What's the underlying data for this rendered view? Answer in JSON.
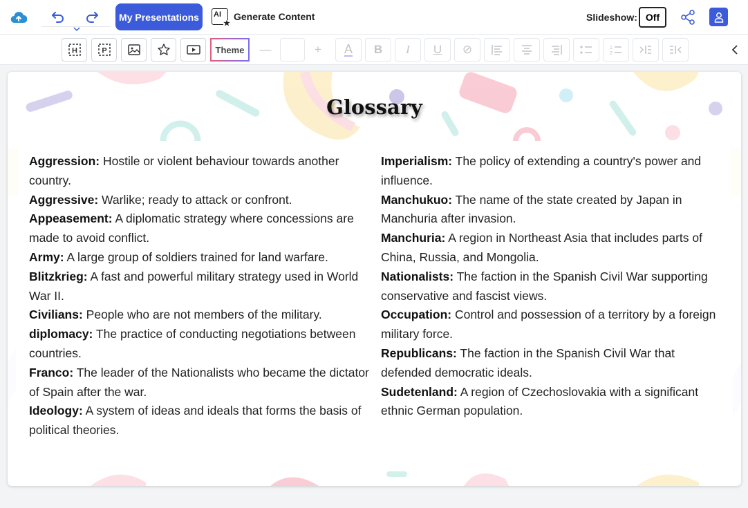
{
  "header": {
    "my_presentations": "My Presentations",
    "generate_content": "Generate Content",
    "ai_badge": "AI",
    "slideshow_label": "Slideshow:",
    "slideshow_state": "Off"
  },
  "toolbar": {
    "theme_label": "Theme",
    "heading_glyph": "H",
    "paragraph_glyph": "P"
  },
  "slide": {
    "title": "Glossary",
    "left_entries": [
      {
        "term": "Aggression:",
        "def": " Hostile or violent behaviour towards another country."
      },
      {
        "term": "Aggressive:",
        "def": " Warlike; ready to attack or confront."
      },
      {
        "term": "Appeasement:",
        "def": " A diplomatic strategy where concessions are made to avoid conflict."
      },
      {
        "term": "Army:",
        "def": " A large group of soldiers trained for land warfare."
      },
      {
        "term": "Blitzkrieg:",
        "def": " A fast and powerful military strategy used in World War II."
      },
      {
        "term": "Civilians:",
        "def": " People who are not members of the military."
      },
      {
        "term": "diplomacy:",
        "def": " The practice of conducting negotiations between countries."
      },
      {
        "term": "Franco:",
        "def": " The leader of the Nationalists who became the dictator of Spain after the war."
      },
      {
        "term": "Ideology:",
        "def": " A system of ideas and ideals that forms the basis of political theories."
      }
    ],
    "right_entries": [
      {
        "term": "Imperialism:",
        "def": " The policy of extending a country's power and influence."
      },
      {
        "term": "Manchukuo:",
        "def": " The name of the state created by Japan in Manchuria after invasion."
      },
      {
        "term": "Manchuria:",
        "def": " A region in Northeast Asia that includes parts of China, Russia, and Mongolia."
      },
      {
        "term": "Nationalists:",
        "def": " The faction in the Spanish Civil War supporting conservative and fascist views."
      },
      {
        "term": "Occupation:",
        "def": " Control and possession of a territory by a foreign military force."
      },
      {
        "term": "Republicans:",
        "def": " The faction in the Spanish Civil War that defended democratic ideals."
      },
      {
        "term": "Sudetenland:",
        "def": " A region of Czechoslovakia with a significant ethnic German population."
      }
    ]
  },
  "colors": {
    "accent": "#3b5bdb",
    "cloud": "#2b8fd6"
  }
}
